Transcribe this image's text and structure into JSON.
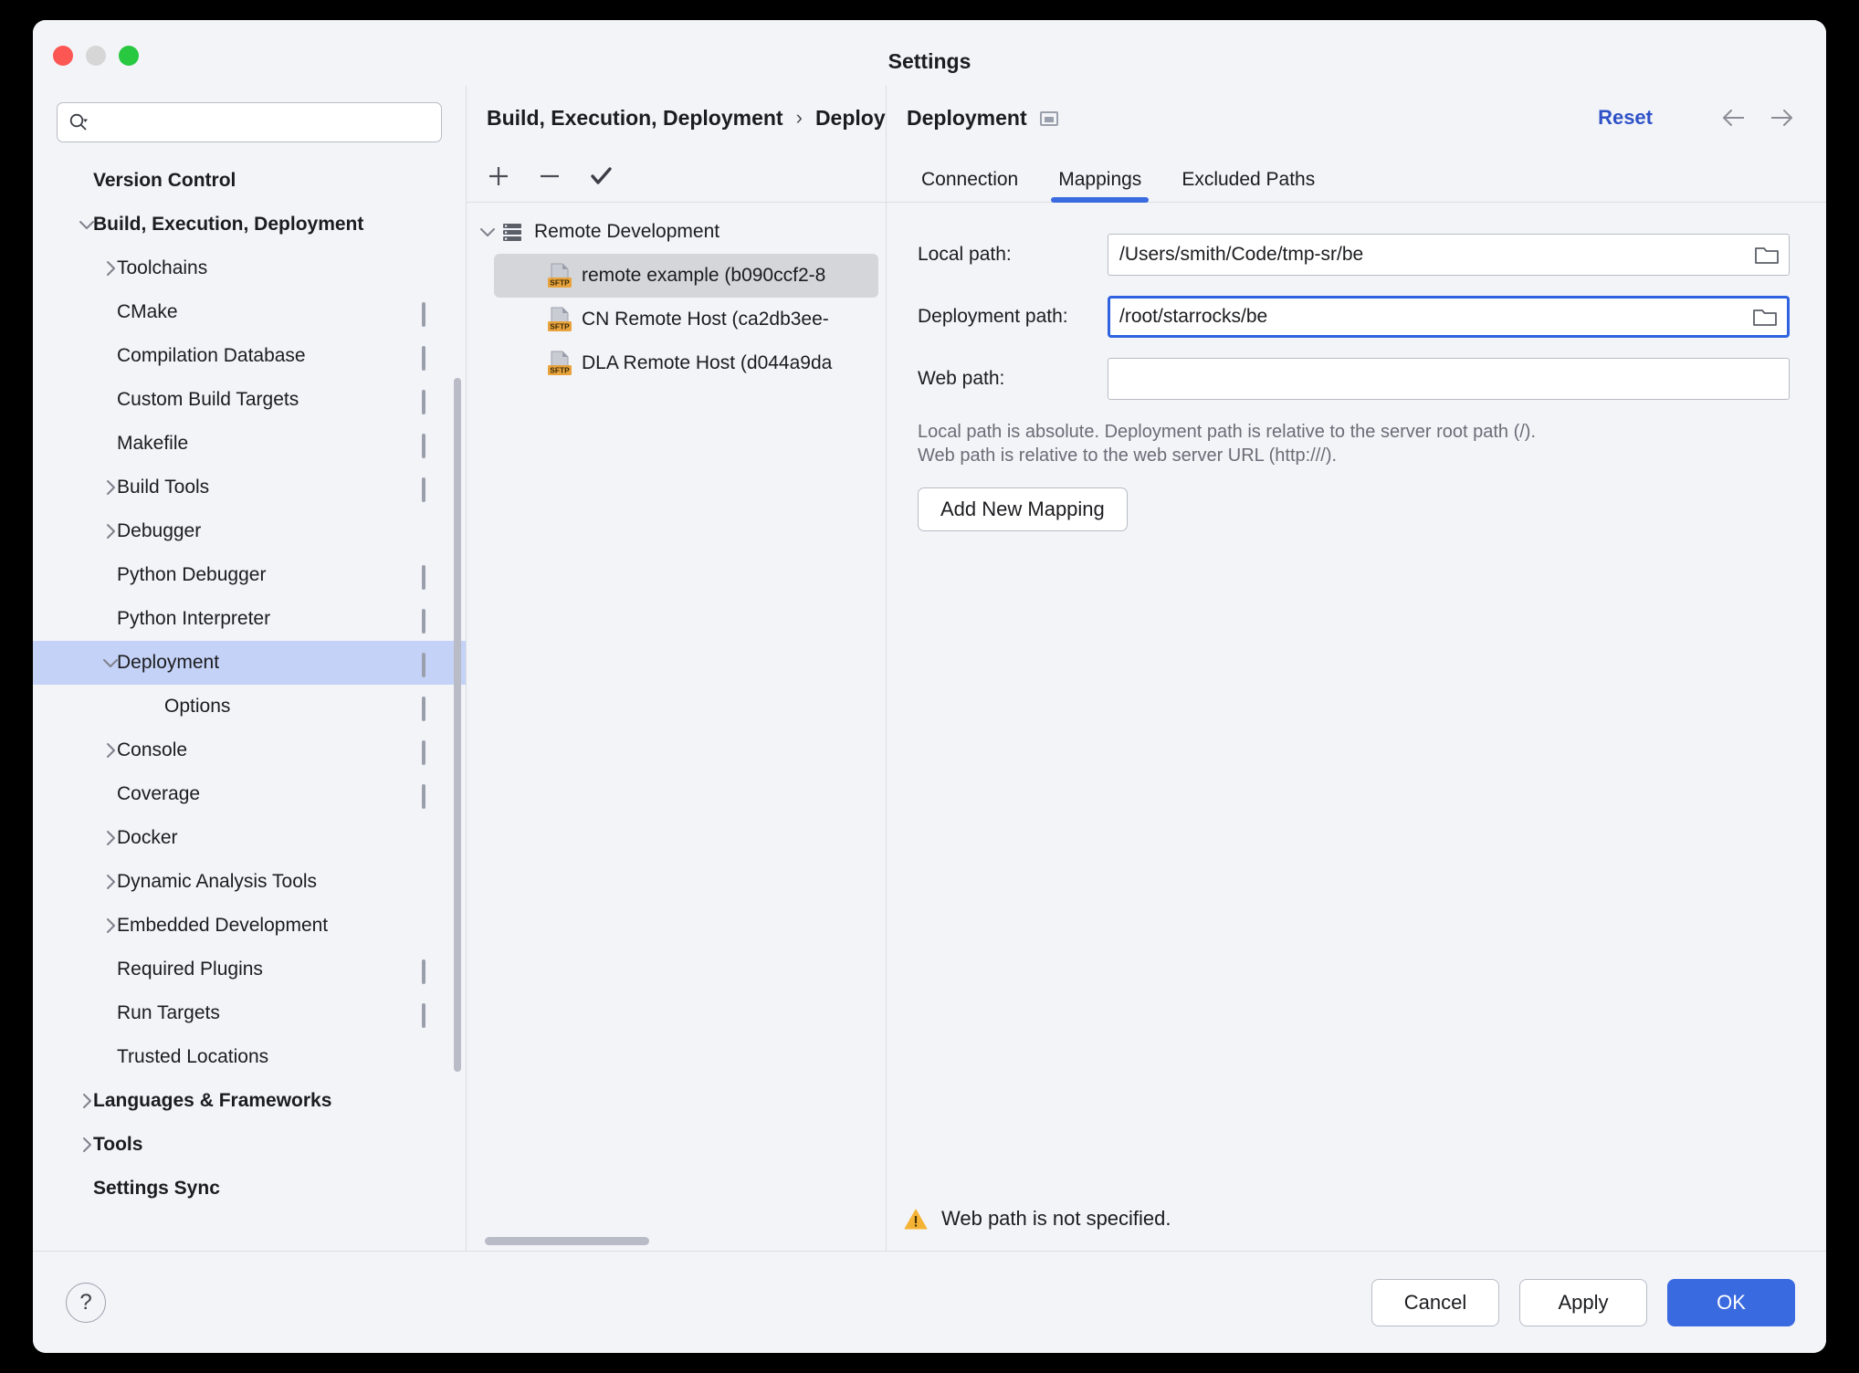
{
  "window": {
    "title": "Settings",
    "traffic": [
      "close",
      "minimize",
      "zoom"
    ]
  },
  "search": {
    "placeholder": "",
    "value": "",
    "icon": "search-icon"
  },
  "sidebar": {
    "items": [
      {
        "label": "Version Control",
        "depth": 0,
        "bold": true,
        "arrow": "none",
        "badge": false,
        "selected": false
      },
      {
        "label": "Build, Execution, Deployment",
        "depth": 0,
        "bold": true,
        "arrow": "down",
        "badge": false,
        "selected": false
      },
      {
        "label": "Toolchains",
        "depth": 1,
        "bold": false,
        "arrow": "right",
        "badge": false,
        "selected": false
      },
      {
        "label": "CMake",
        "depth": 1,
        "bold": false,
        "arrow": "none",
        "badge": true,
        "selected": false
      },
      {
        "label": "Compilation Database",
        "depth": 1,
        "bold": false,
        "arrow": "none",
        "badge": true,
        "selected": false
      },
      {
        "label": "Custom Build Targets",
        "depth": 1,
        "bold": false,
        "arrow": "none",
        "badge": true,
        "selected": false
      },
      {
        "label": "Makefile",
        "depth": 1,
        "bold": false,
        "arrow": "none",
        "badge": true,
        "selected": false
      },
      {
        "label": "Build Tools",
        "depth": 1,
        "bold": false,
        "arrow": "right",
        "badge": true,
        "selected": false
      },
      {
        "label": "Debugger",
        "depth": 1,
        "bold": false,
        "arrow": "right",
        "badge": false,
        "selected": false
      },
      {
        "label": "Python Debugger",
        "depth": 1,
        "bold": false,
        "arrow": "none",
        "badge": true,
        "selected": false
      },
      {
        "label": "Python Interpreter",
        "depth": 1,
        "bold": false,
        "arrow": "none",
        "badge": true,
        "selected": false
      },
      {
        "label": "Deployment",
        "depth": 1,
        "bold": false,
        "arrow": "down",
        "badge": true,
        "selected": true
      },
      {
        "label": "Options",
        "depth": 2,
        "bold": false,
        "arrow": "none",
        "badge": true,
        "selected": false
      },
      {
        "label": "Console",
        "depth": 1,
        "bold": false,
        "arrow": "right",
        "badge": true,
        "selected": false
      },
      {
        "label": "Coverage",
        "depth": 1,
        "bold": false,
        "arrow": "none",
        "badge": true,
        "selected": false
      },
      {
        "label": "Docker",
        "depth": 1,
        "bold": false,
        "arrow": "right",
        "badge": false,
        "selected": false
      },
      {
        "label": "Dynamic Analysis Tools",
        "depth": 1,
        "bold": false,
        "arrow": "right",
        "badge": false,
        "selected": false
      },
      {
        "label": "Embedded Development",
        "depth": 1,
        "bold": false,
        "arrow": "right",
        "badge": false,
        "selected": false
      },
      {
        "label": "Required Plugins",
        "depth": 1,
        "bold": false,
        "arrow": "none",
        "badge": true,
        "selected": false
      },
      {
        "label": "Run Targets",
        "depth": 1,
        "bold": false,
        "arrow": "none",
        "badge": true,
        "selected": false
      },
      {
        "label": "Trusted Locations",
        "depth": 1,
        "bold": false,
        "arrow": "none",
        "badge": false,
        "selected": false
      },
      {
        "label": "Languages & Frameworks",
        "depth": 0,
        "bold": true,
        "arrow": "right",
        "badge": false,
        "selected": false
      },
      {
        "label": "Tools",
        "depth": 0,
        "bold": true,
        "arrow": "right",
        "badge": false,
        "selected": false
      },
      {
        "label": "Settings Sync",
        "depth": 0,
        "bold": true,
        "arrow": "none",
        "badge": false,
        "selected": false
      }
    ]
  },
  "breadcrumb": {
    "parent": "Build, Execution, Deployment",
    "separator": "›",
    "current": "Deployment"
  },
  "servers_toolbar": {
    "add": "+",
    "remove": "−",
    "check": "✓"
  },
  "servers": {
    "group": "Remote Development",
    "items": [
      {
        "label": "remote example (b090ccf2-8",
        "protocol": "SFTP",
        "selected": true
      },
      {
        "label": "CN Remote Host (ca2db3ee-",
        "protocol": "SFTP",
        "selected": false
      },
      {
        "label": "DLA Remote Host (d044a9da",
        "protocol": "SFTP",
        "selected": false
      }
    ]
  },
  "right": {
    "reset_label": "Reset",
    "back_icon": "arrow-left-icon",
    "forward_icon": "arrow-right-icon",
    "tabs": [
      {
        "label": "Connection",
        "active": false
      },
      {
        "label": "Mappings",
        "active": true
      },
      {
        "label": "Excluded Paths",
        "active": false
      }
    ],
    "fields": [
      {
        "label": "Local path:",
        "value": "/Users/smith/Code/tmp-sr/be",
        "placeholder": "",
        "focused": false,
        "browse": true
      },
      {
        "label": "Deployment path:",
        "value": "/root/starrocks/be",
        "placeholder": "",
        "focused": true,
        "browse": true
      },
      {
        "label": "Web path:",
        "value": "",
        "placeholder": "",
        "focused": false,
        "browse": false
      }
    ],
    "hint_line1": "Local path is absolute. Deployment path is relative to the server root path (/).",
    "hint_line2": "Web path is relative to the web server URL (http:///).",
    "add_mapping_label": "Add New Mapping",
    "warning": "Web path is not specified.",
    "warning_icon": "warning-triangle-icon"
  },
  "footer": {
    "help": "?",
    "cancel": "Cancel",
    "apply": "Apply",
    "ok": "OK"
  },
  "colors": {
    "accent": "#3a6ae0",
    "link": "#2f52c8",
    "selection": "#c5d2f7",
    "row_selection": "#d4d6da",
    "warning": "#f5b335",
    "sftp_badge": "#e8a33d"
  }
}
